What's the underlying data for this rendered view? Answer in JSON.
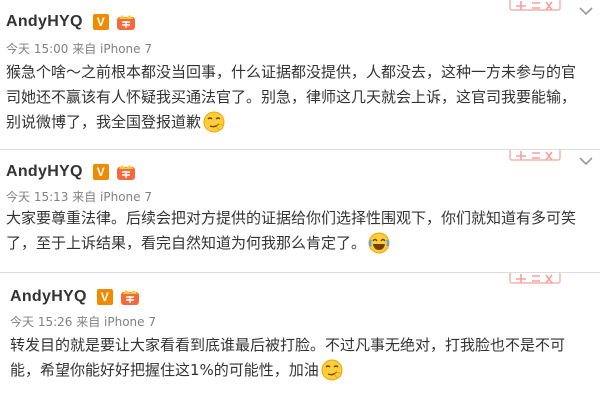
{
  "posts": [
    {
      "author": "AndyHYQ",
      "verified_badge": "V",
      "meta": "今天 15:00 来自 iPhone 7",
      "text": "猴急个啥～之前根本都没当回事，什么证据都没提供，人都没去，这种一方未参与的官司她还不赢该有人怀疑我买通法官了。别急，律师这几天就会上诉，这官司我要能输，别说微博了，我全国登报道歉",
      "emoji": "smirk-emoji-icon"
    },
    {
      "author": "AndyHYQ",
      "verified_badge": "V",
      "meta": "今天 15:13 来自 iPhone 7",
      "text": "大家要尊重法律。后续会把对方提供的证据给你们选择性围观下，你们就知道有多可笑了，至于上诉结果，看完自然知道为何我那么肯定了。",
      "emoji": "laugh-tears-emoji-icon"
    },
    {
      "author": "AndyHYQ",
      "verified_badge": "V",
      "meta": "今天 15:26 来自 iPhone 7",
      "text": "转发目的就是要让大家看看到底谁最后被打脸。不过凡事无绝对，打我脸也不是不可能，希望你能好好把握住这1%的可能性，加油",
      "emoji": "smirk-emoji-icon"
    }
  ],
  "colors": {
    "badge_orange": "#f08b00",
    "text": "#333333",
    "meta": "#808080",
    "stamp_red": "#e8453c"
  }
}
